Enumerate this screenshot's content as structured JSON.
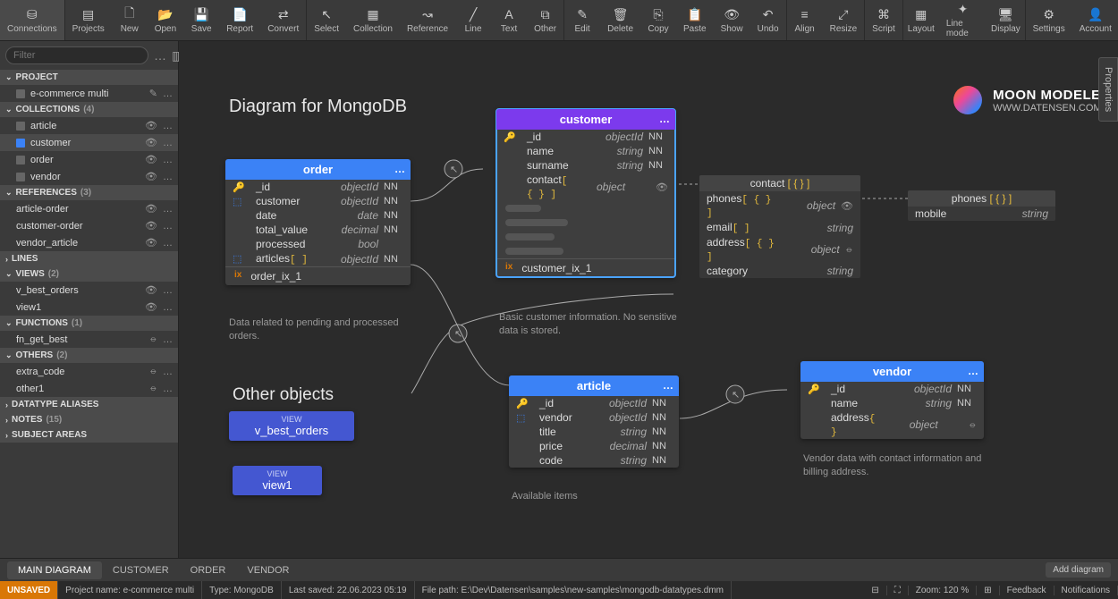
{
  "toolbar": {
    "groups": [
      [
        {
          "icon": "⛁",
          "label": "Connections"
        }
      ],
      [
        {
          "icon": "▤",
          "label": "Projects"
        },
        {
          "icon": "🗋",
          "label": "New"
        },
        {
          "icon": "📂",
          "label": "Open"
        },
        {
          "icon": "💾",
          "label": "Save"
        },
        {
          "icon": "📄",
          "label": "Report"
        },
        {
          "icon": "⇄",
          "label": "Convert"
        }
      ],
      [
        {
          "icon": "↖",
          "label": "Select"
        },
        {
          "icon": "▦",
          "label": "Collection"
        },
        {
          "icon": "↝",
          "label": "Reference"
        },
        {
          "icon": "╱",
          "label": "Line"
        },
        {
          "icon": "A",
          "label": "Text"
        },
        {
          "icon": "⧉",
          "label": "Other"
        }
      ],
      [
        {
          "icon": "✎",
          "label": "Edit"
        },
        {
          "icon": "🗑",
          "label": "Delete"
        },
        {
          "icon": "⎘",
          "label": "Copy"
        },
        {
          "icon": "📋",
          "label": "Paste"
        },
        {
          "icon": "👁",
          "label": "Show"
        },
        {
          "icon": "↶",
          "label": "Undo"
        }
      ],
      [
        {
          "icon": "≡",
          "label": "Align"
        },
        {
          "icon": "⤢",
          "label": "Resize"
        }
      ],
      [
        {
          "icon": "⌘",
          "label": "Script"
        }
      ],
      [
        {
          "icon": "▦",
          "label": "Layout"
        },
        {
          "icon": "✦",
          "label": "Line mode"
        },
        {
          "icon": "🖥",
          "label": "Display"
        }
      ],
      [
        {
          "icon": "⚙",
          "label": "Settings"
        },
        {
          "icon": "👤",
          "label": "Account"
        }
      ]
    ]
  },
  "sidebar": {
    "filter_placeholder": "Filter",
    "sections": [
      {
        "title": "PROJECT",
        "count": "",
        "items": [
          {
            "name": "e-commerce multi",
            "edit": true
          }
        ]
      },
      {
        "title": "COLLECTIONS",
        "count": "(4)",
        "items": [
          {
            "name": "article",
            "eye": true
          },
          {
            "name": "customer",
            "eye": true,
            "selected": true,
            "blue": true
          },
          {
            "name": "order",
            "eye": true
          },
          {
            "name": "vendor",
            "eye": true
          }
        ]
      },
      {
        "title": "REFERENCES",
        "count": "(3)",
        "items": [
          {
            "name": "article-order",
            "eye": true
          },
          {
            "name": "customer-order",
            "eye": true
          },
          {
            "name": "vendor_article",
            "eye": true
          }
        ]
      },
      {
        "title": "LINES",
        "count": "",
        "items": []
      },
      {
        "title": "VIEWS",
        "count": "(2)",
        "items": [
          {
            "name": "v_best_orders",
            "eye": true
          },
          {
            "name": "view1",
            "eye": true
          }
        ]
      },
      {
        "title": "FUNCTIONS",
        "count": "(1)",
        "items": [
          {
            "name": "fn_get_best",
            "hidden": true
          }
        ]
      },
      {
        "title": "OTHERS",
        "count": "(2)",
        "items": [
          {
            "name": "extra_code",
            "hidden": true
          },
          {
            "name": "other1",
            "hidden": true
          }
        ]
      },
      {
        "title": "DATATYPE ALIASES",
        "count": "",
        "items": []
      },
      {
        "title": "NOTES",
        "count": "(15)",
        "items": []
      },
      {
        "title": "SUBJECT AREAS",
        "count": "",
        "items": []
      }
    ]
  },
  "canvas": {
    "title": "Diagram for MongoDB",
    "other_title": "Other objects",
    "logo": {
      "name": "MOON MODELER",
      "url": "WWW.DATENSEN.COM"
    },
    "order": {
      "title": "order",
      "color": "#3b82f6",
      "fields": [
        {
          "key": "pk",
          "name": "_id",
          "type": "objectId",
          "nn": "NN"
        },
        {
          "key": "fk",
          "name": "customer",
          "type": "objectId",
          "nn": "NN"
        },
        {
          "key": "",
          "name": "date",
          "type": "date",
          "nn": "NN"
        },
        {
          "key": "",
          "name": "total_value",
          "type": "decimal",
          "nn": "NN"
        },
        {
          "key": "",
          "name": "processed",
          "type": "bool",
          "nn": ""
        },
        {
          "key": "fk",
          "name": "articles",
          "br": "[ ]",
          "type": "objectId",
          "nn": "NN"
        }
      ],
      "index": "order_ix_1",
      "note": "Data related to pending and processed orders."
    },
    "customer": {
      "title": "customer",
      "color": "#7c3aed",
      "fields": [
        {
          "key": "pk",
          "name": "_id",
          "type": "objectId",
          "nn": "NN"
        },
        {
          "key": "",
          "name": "name",
          "type": "string",
          "nn": "NN"
        },
        {
          "key": "",
          "name": "surname",
          "type": "string",
          "nn": "NN"
        },
        {
          "key": "",
          "name": "contact",
          "br": "[ { } ]",
          "type": "object",
          "nn": "",
          "eye": true
        }
      ],
      "index": "customer_ix_1",
      "note": "Basic customer information. No sensitive data is stored."
    },
    "contact": {
      "title": "contact",
      "br": "[ { } ]",
      "fields": [
        {
          "name": "phones",
          "br": "[ { } ]",
          "type": "object",
          "eye": true
        },
        {
          "name": "email",
          "br": "[ ]",
          "type": "string"
        },
        {
          "name": "address",
          "br": "[ { } ]",
          "type": "object",
          "hidden": true
        },
        {
          "name": "category",
          "type": "string"
        }
      ]
    },
    "phones": {
      "title": "phones",
      "br": "[ { } ]",
      "fields": [
        {
          "name": "mobile",
          "type": "string"
        }
      ]
    },
    "article": {
      "title": "article",
      "color": "#3b82f6",
      "fields": [
        {
          "key": "pk",
          "name": "_id",
          "type": "objectId",
          "nn": "NN"
        },
        {
          "key": "fk",
          "name": "vendor",
          "type": "objectId",
          "nn": "NN"
        },
        {
          "key": "",
          "name": "title",
          "type": "string",
          "nn": "NN"
        },
        {
          "key": "",
          "name": "price",
          "type": "decimal",
          "nn": "NN"
        },
        {
          "key": "",
          "name": "code",
          "type": "string",
          "nn": "NN"
        }
      ],
      "note": "Available items"
    },
    "vendor": {
      "title": "vendor",
      "color": "#3b82f6",
      "fields": [
        {
          "key": "pk",
          "name": "_id",
          "type": "objectId",
          "nn": "NN"
        },
        {
          "key": "",
          "name": "name",
          "type": "string",
          "nn": "NN"
        },
        {
          "key": "",
          "name": "address",
          "br": "{ }",
          "type": "object",
          "nn": "",
          "hidden": true
        }
      ],
      "note": "Vendor data with contact information and billing address."
    },
    "views": [
      {
        "name": "v_best_orders",
        "type": "VIEW"
      },
      {
        "name": "view1",
        "type": "VIEW"
      }
    ]
  },
  "tabs": [
    "MAIN DIAGRAM",
    "CUSTOMER",
    "ORDER",
    "VENDOR"
  ],
  "add_diagram": "Add diagram",
  "properties_tab": "Properties",
  "statusbar": {
    "unsaved": "UNSAVED",
    "project": "Project name: e-commerce multi",
    "type": "Type: MongoDB",
    "saved": "Last saved: 22.06.2023 05:19",
    "path": "File path: E:\\Dev\\Datensen\\samples\\new-samples\\mongodb-datatypes.dmm",
    "zoom": "Zoom: 120 %",
    "feedback": "Feedback",
    "notifications": "Notifications"
  }
}
